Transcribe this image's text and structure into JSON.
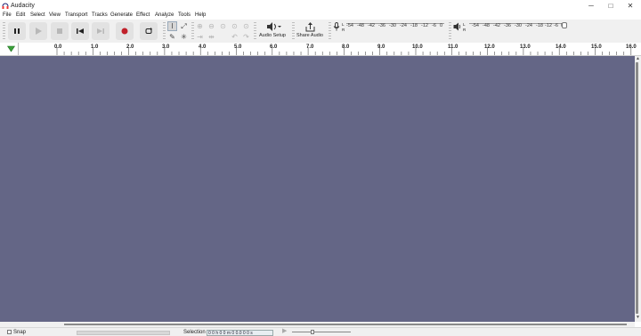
{
  "window": {
    "title": "Audacity",
    "controls": {
      "minimize": "─",
      "maximize": "□",
      "close": "✕"
    }
  },
  "menu": [
    "File",
    "Edit",
    "Select",
    "View",
    "Transport",
    "Tracks",
    "Generate",
    "Effect",
    "Analyze",
    "Tools",
    "Help"
  ],
  "toolbar": {
    "transport": [
      {
        "name": "pause",
        "icon": "pause-icon"
      },
      {
        "name": "play",
        "icon": "play-icon"
      },
      {
        "name": "stop",
        "icon": "stop-icon"
      },
      {
        "name": "skip-start",
        "icon": "skip-to-start-icon"
      },
      {
        "name": "skip-end",
        "icon": "skip-to-end-icon"
      },
      {
        "name": "record",
        "icon": "record-icon"
      },
      {
        "name": "loop",
        "icon": "loop-icon"
      }
    ],
    "audio_setup_label": "Audio Setup",
    "share_audio_label": "Share Audio",
    "record_meter_labels": [
      "-54",
      "-48",
      "-42",
      "-36",
      "-30",
      "-24",
      "-18",
      "-12",
      "-6",
      "0"
    ],
    "play_meter_labels": [
      "-54",
      "-48",
      "-42",
      "-36",
      "-30",
      "-24",
      "-18",
      "-12",
      "-6",
      "0"
    ],
    "meter_channel_labels": {
      "left": "L",
      "right": "R"
    }
  },
  "ruler": {
    "labels": [
      "0.0",
      "1.0",
      "2.0",
      "3.0",
      "4.0",
      "5.0",
      "6.0",
      "7.0",
      "8.0",
      "9.0",
      "10.0",
      "11.0",
      "12.0",
      "13.0",
      "14.0",
      "15.0",
      "16.0"
    ]
  },
  "status": {
    "snap_label": "Snap",
    "selection_label": "Selection",
    "selection_value": "0 0 h 0 0 m 0 0.0 0 0 s"
  },
  "colors": {
    "track_background": "#646686",
    "record_button": "#c0202a",
    "ruler_marker": "#3aa03a"
  }
}
